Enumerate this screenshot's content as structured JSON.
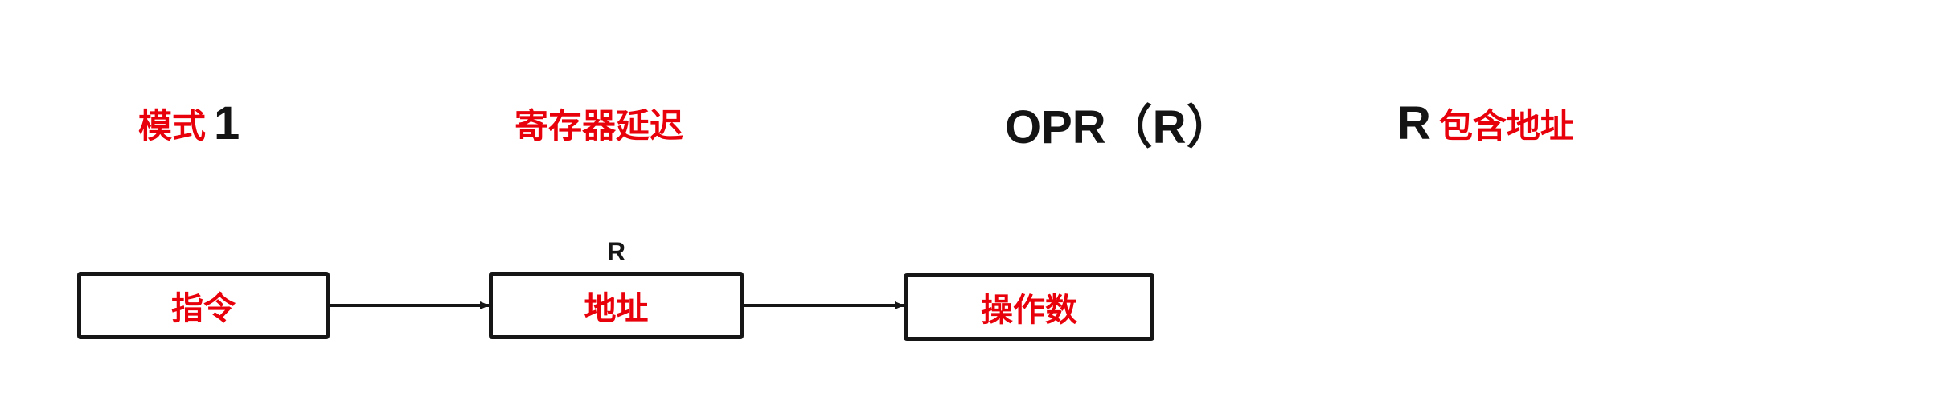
{
  "header": {
    "mode_label": "模式",
    "mode_number": "1",
    "mode_name": "寄存器延迟",
    "syntax": "OPR（R）",
    "desc_prefix": "R",
    "desc_text": "包含地址"
  },
  "diagram": {
    "register_label": "R",
    "boxes": [
      {
        "label": "指令"
      },
      {
        "label": "地址"
      },
      {
        "label": "操作数"
      }
    ]
  },
  "colors": {
    "label_red": "#e8000b",
    "ink": "#161616"
  }
}
